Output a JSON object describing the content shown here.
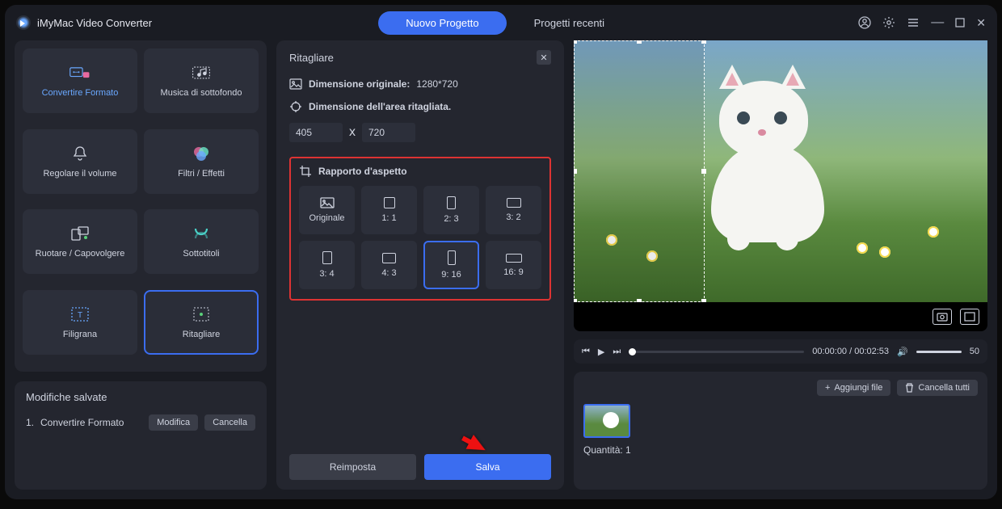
{
  "app_title": "iMyMac Video Converter",
  "tabs": {
    "new": "Nuovo Progetto",
    "recent": "Progetti recenti"
  },
  "left": {
    "tools": [
      {
        "label": "Convertire Formato"
      },
      {
        "label": "Musica di sottofondo"
      },
      {
        "label": "Regolare il volume"
      },
      {
        "label": "Filtri / Effetti"
      },
      {
        "label": "Ruotare / Capovolgere"
      },
      {
        "label": "Sottotitoli"
      },
      {
        "label": "Filigrana"
      },
      {
        "label": "Ritagliare"
      }
    ],
    "saved_title": "Modifiche salvate",
    "saved_item": "Convertire Formato",
    "saved_index": "1.",
    "edit_btn": "Modifica",
    "cancel_btn": "Cancella"
  },
  "center": {
    "title": "Ritagliare",
    "orig_label": "Dimensione originale:",
    "orig_value": "1280*720",
    "crop_label": "Dimensione dell'area ritagliata.",
    "width": "405",
    "x": "x",
    "height": "720",
    "aspect_title": "Rapporto d'aspetto",
    "aspects": [
      {
        "label": "Originale"
      },
      {
        "label": "1:  1"
      },
      {
        "label": "2:  3"
      },
      {
        "label": "3:  2"
      },
      {
        "label": "3:  4"
      },
      {
        "label": "4:  3"
      },
      {
        "label": "9:  16"
      },
      {
        "label": "16:  9"
      }
    ],
    "reset": "Reimposta",
    "save": "Salva"
  },
  "right": {
    "time": "00:00:00 / 00:02:53",
    "volume": "50",
    "add_file": "Aggiungi file",
    "delete_all": "Cancella tutti",
    "qty_label": "Quantità:",
    "qty_value": "1"
  }
}
